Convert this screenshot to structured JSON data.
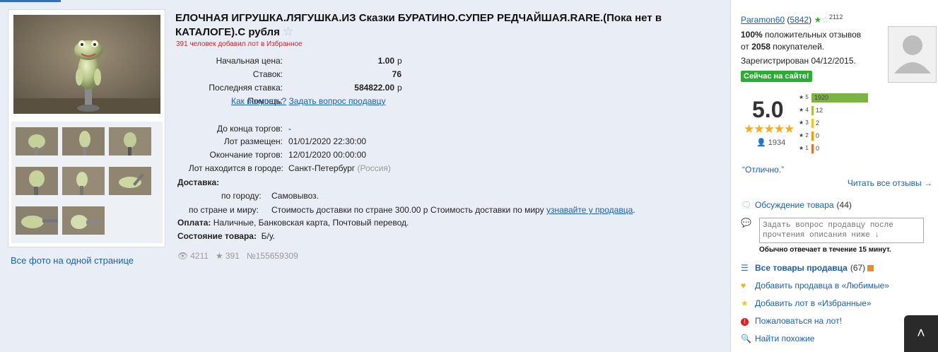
{
  "gallery": {
    "all_photos": "Все фото на одной странице"
  },
  "lot": {
    "title": "ЕЛОЧНАЯ ИГРУШКА.ЛЯГУШКА.ИЗ Сказки БУРАТИНО.СУПЕР РЕДЧАЙШАЯ.RARE.(Пока нет в КАТАЛОГЕ).С рубля",
    "favorited_note": "391 человек добавил лот в Избранное",
    "start_price_label": "Начальная цена:",
    "start_price": "1.00",
    "bids_label": "Ставок:",
    "bids": "76",
    "last_bid_label": "Последняя ставка:",
    "last_bid": "584822.00",
    "currency": "р",
    "help_label": "Помощь:",
    "help_link1": "Как покупать?",
    "help_link2": "Задать вопрос продавцу",
    "ends_in_label": "До конца торгов:",
    "ends_in": "-",
    "placed_label": "Лот размещен:",
    "placed": "01/01/2020 22:30:00",
    "end_label": "Окончание торгов:",
    "end": "12/01/2020 00:00:00",
    "city_label": "Лот находится в городе:",
    "city": "Санкт-Петербург",
    "country": "(Россия)",
    "delivery_label": "Доставка:",
    "delivery_city_label": "по городу:",
    "delivery_city": "Самовывоз.",
    "delivery_world_label": "по стране и миру:",
    "delivery_world": "Стоимость доставки по стране 300.00 р Стоимость доставки по миру",
    "delivery_world_link": "узнавайте у продавца",
    "payment_label": "Оплата:",
    "payment": "Наличные, Банковская карта, Почтовый перевод.",
    "condition_label": "Состояние товара:",
    "condition": "Б/у.",
    "views": "4211",
    "stars": "391",
    "lot_number": "№155659309"
  },
  "seller": {
    "name": "Paramon60",
    "rating_link": "5842",
    "sup": "2112",
    "positive_pct": "100%",
    "positive_text": "положительных отзывов",
    "from_text": "от",
    "buyers_count": "2058",
    "buyers_text": "покупателей.",
    "registered": "Зарегистрирован 04/12/2015.",
    "online": "Сейчас на сайте!",
    "score": "5.0",
    "score_stars": "★★★★★",
    "reviews_count": "1934",
    "bars": [
      {
        "level": "★ 5",
        "count": 1920,
        "label": "1920",
        "color": "#7cb342"
      },
      {
        "level": "★ 4",
        "count": 12,
        "label": "12",
        "color": "#a5c936"
      },
      {
        "level": "★ 3",
        "count": 2,
        "label": "2",
        "color": "#f0c419"
      },
      {
        "level": "★ 2",
        "count": 0,
        "label": "0",
        "color": "#f39c12"
      },
      {
        "level": "★ 1",
        "count": 0,
        "label": "0",
        "color": "#e8702a"
      }
    ],
    "quote": "“Отлично.”",
    "read_all": "Читать все отзывы →"
  },
  "actions": {
    "discussion": "Обсуждение товара",
    "discussion_count": "(44)",
    "ask_placeholder": "Задать вопрос продавцу после прочтения описания ниже ↓",
    "reply_note": "Обычно отвечает в течение 15 минут.",
    "all_items": "Все товары продавца",
    "all_items_count": "(67)",
    "add_favorite_seller": "Добавить продавца в «Любимые»",
    "add_favorite_lot": "Добавить лот в «Избранные»",
    "complain": "Пожаловаться на лот!",
    "find_similar": "Найти похожие"
  }
}
